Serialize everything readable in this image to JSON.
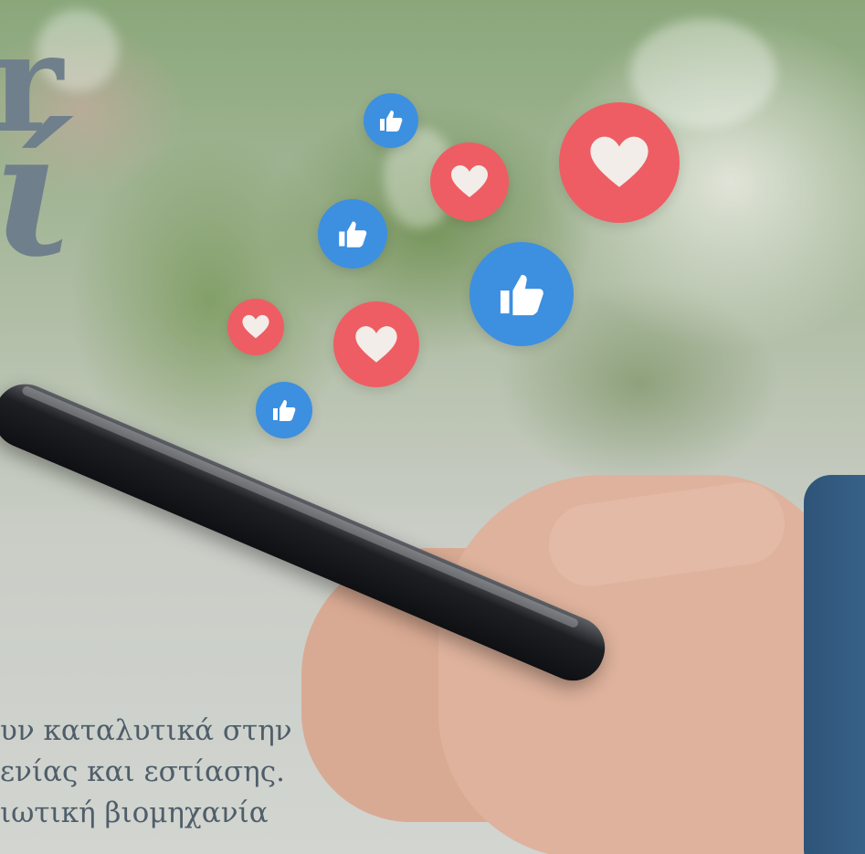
{
  "headline": {
    "line1": "r",
    "line2": "ί"
  },
  "caption": {
    "line1": "υν καταλυτικά στην",
    "line2": "ενίας και εστίασης.",
    "line3": "ιωτική βιομηχανία"
  },
  "reactions": [
    {
      "kind": "like",
      "icon": "thumbs-up-icon"
    },
    {
      "kind": "heart",
      "icon": "heart-icon"
    },
    {
      "kind": "heart",
      "icon": "heart-icon"
    },
    {
      "kind": "like",
      "icon": "thumbs-up-icon"
    },
    {
      "kind": "like",
      "icon": "thumbs-up-icon"
    },
    {
      "kind": "heart",
      "icon": "heart-icon"
    },
    {
      "kind": "heart",
      "icon": "heart-icon"
    },
    {
      "kind": "like",
      "icon": "thumbs-up-icon"
    }
  ],
  "colors": {
    "like": "#3d8fe0",
    "heart": "#ee5d63",
    "headline": "#6f7f8b",
    "caption": "#4f5e6a"
  }
}
